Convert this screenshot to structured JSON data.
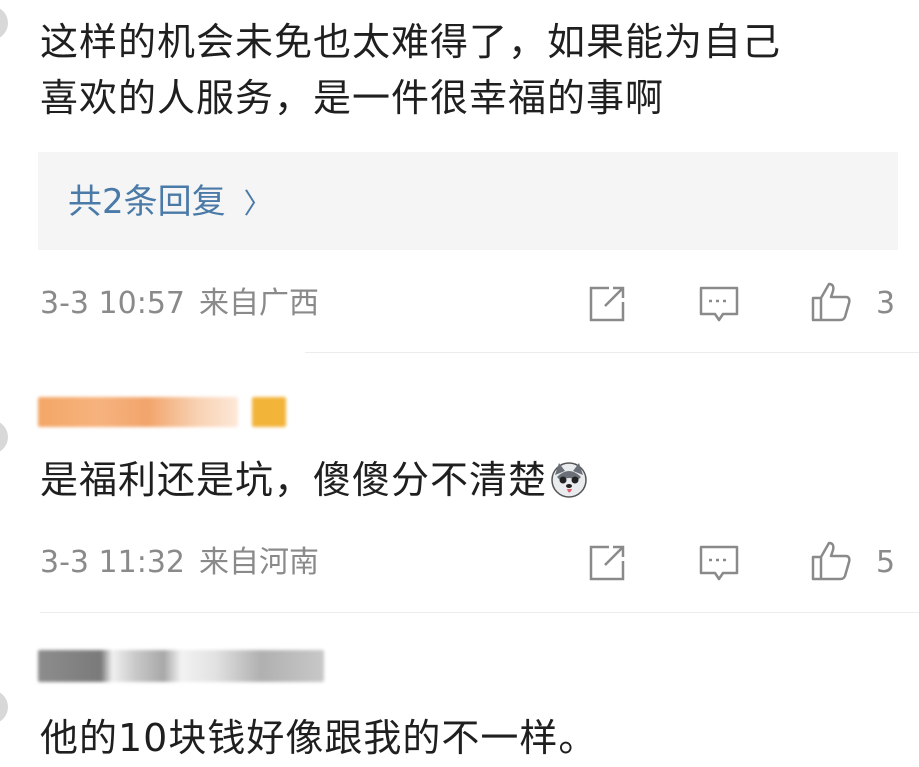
{
  "comments": [
    {
      "text_line1": "这样的机会未免也太难得了，如果能为自己",
      "text_line2": "喜欢的人服务，是一件很幸福的事啊",
      "replies_label": "共2条回复",
      "time": "3-3 10:57",
      "location": "来自广西",
      "likes": "3"
    },
    {
      "text": "是福利还是坑，傻傻分不清楚",
      "time": "3-3 11:32",
      "location": "来自河南",
      "likes": "5"
    },
    {
      "text": "他的10块钱好像跟我的不一样。"
    }
  ],
  "icons": {
    "share": "share-icon",
    "comment": "comment-icon",
    "like": "thumbs-up-icon",
    "emoji": "husky-emoji-icon"
  },
  "colors": {
    "link": "#4a7aa8",
    "meta": "#8a8a8a",
    "username_blur_1": "#f0a060",
    "username_blur_2": "#9a9a9a"
  }
}
